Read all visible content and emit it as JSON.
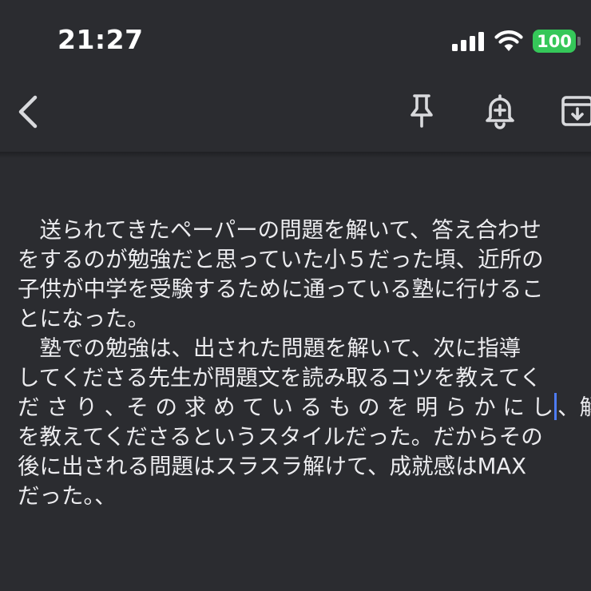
{
  "status_bar": {
    "time": "21:27",
    "battery": "100",
    "signal_bars": 4,
    "icons": [
      "signal-icon",
      "wifi-icon",
      "battery-icon"
    ]
  },
  "toolbar": {
    "icons": [
      "back-arrow-icon",
      "pin-icon",
      "reminder-bell-icon",
      "archive-icon"
    ]
  },
  "note": {
    "lines": [
      "　送られてきたペーパーの問題を解いて、答え合わせ",
      "をするのが勉強だと思っていた小５だった頃、近所の",
      "子供が中学を受験するために通っている塾に行けるこ",
      "とになった。",
      "　塾での勉強は、出された問題を解いて、次に指導",
      "してくださる先生が問題文を読み取るコツを教えてく",
      "だ さ り 、そ の 求 め て い る も の を 明 ら か に し",
      "、解き方",
      "を教えてくださるというスタイルだった。だからその",
      "後に出される問題はスラスラ解けて、成就感はMAX",
      "だった。、"
    ]
  },
  "colors": {
    "background": "#2b2c30",
    "text": "#ececef",
    "battery": "#35c759",
    "caret": "#4d7cf5"
  }
}
